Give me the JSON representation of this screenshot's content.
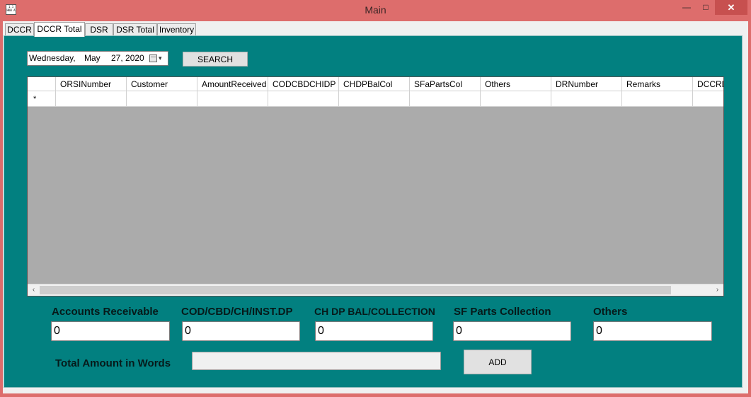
{
  "window": {
    "title": "Main",
    "icon_text": "1.1 HKH A",
    "minimize_glyph": "—",
    "maximize_glyph": "□",
    "close_glyph": "✕"
  },
  "tabs": [
    {
      "label": "DCCR"
    },
    {
      "label": "DCCR Total",
      "active": true
    },
    {
      "label": "DSR"
    },
    {
      "label": "DSR Total"
    },
    {
      "label": "Inventory"
    }
  ],
  "date_picker": {
    "weekday": "Wednesday,",
    "month": "May",
    "day_year": "27, 2020",
    "dropdown_glyph": "▾"
  },
  "search_button": "SEARCH",
  "grid": {
    "columns": [
      "ORSINumber",
      "Customer",
      "AmountReceived",
      "CODCBDCHIDP",
      "CHDPBalCol",
      "SFaPartsCol",
      "Others",
      "DRNumber",
      "Remarks",
      "DCCRD"
    ],
    "new_row_marker": "*",
    "scroll_left_glyph": "‹",
    "scroll_right_glyph": "›"
  },
  "totals": [
    {
      "label": "Accounts Receivable",
      "value": "0"
    },
    {
      "label": "COD/CBD/CH/INST.DP",
      "value": "0"
    },
    {
      "label": "CH  DP BAL/COLLECTION",
      "value": "0"
    },
    {
      "label": "SF  Parts Collection",
      "value": "0"
    },
    {
      "label": "Others",
      "value": "0"
    }
  ],
  "words": {
    "label": "Total Amount in Words",
    "value": ""
  },
  "add_button": "ADD",
  "colors": {
    "title_bar": "#dd6d6c",
    "panel": "#028080",
    "grid_background": "#ababab",
    "close_button": "#c7504f"
  }
}
